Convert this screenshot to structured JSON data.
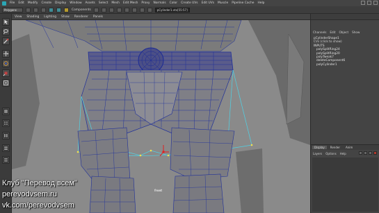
{
  "menubar": {
    "items": [
      "File",
      "Edit",
      "Modify",
      "Create",
      "Display",
      "Window",
      "Assets",
      "Select",
      "Mesh",
      "Edit Mesh",
      "Proxy",
      "Normals",
      "Color",
      "Create UVs",
      "Edit UVs",
      "Muscle",
      "Pipeline Cache",
      "Help"
    ]
  },
  "statusline": {
    "mode": "Polygons",
    "components_label": "Components",
    "selection_field": "pCylinder1.vtx[55:57]",
    "right_status": "Channel Box / Layer Editor"
  },
  "viewport": {
    "menu": [
      "View",
      "Shading",
      "Lighting",
      "Show",
      "Renderer",
      "Panels"
    ],
    "camera_label": "front"
  },
  "channel_box": {
    "tabs": [
      "Channels",
      "Edit",
      "Object",
      "Show"
    ],
    "nodes": [
      {
        "label": "pCylinderShape1",
        "type": "shape"
      },
      {
        "label": "CVs (click to show)",
        "type": "sub"
      },
      {
        "label": "INPUTS",
        "type": "header"
      },
      {
        "label": "polySplitRing24",
        "type": "input"
      },
      {
        "label": "polySplitRing20",
        "type": "input"
      },
      {
        "label": "polyTweak7",
        "type": "input"
      },
      {
        "label": "deleteComponent6",
        "type": "input"
      },
      {
        "label": "polyCylinder1",
        "type": "input"
      }
    ]
  },
  "layer_editor": {
    "tabs": [
      "Display",
      "Render",
      "Anim"
    ],
    "active_tab": "Display",
    "menu": [
      "Layers",
      "Options",
      "Help"
    ]
  },
  "watermark": {
    "line1": "Клуб \"Перевод всем\"",
    "line2": "perevodvsem.ru",
    "line3": "vk.com/perevodvsem"
  },
  "colors": {
    "wire": "#1f2f9a",
    "selected_edge": "#4fd3e6",
    "vertex_highlight": "#f5e04a",
    "manip_red": "#e02020"
  }
}
